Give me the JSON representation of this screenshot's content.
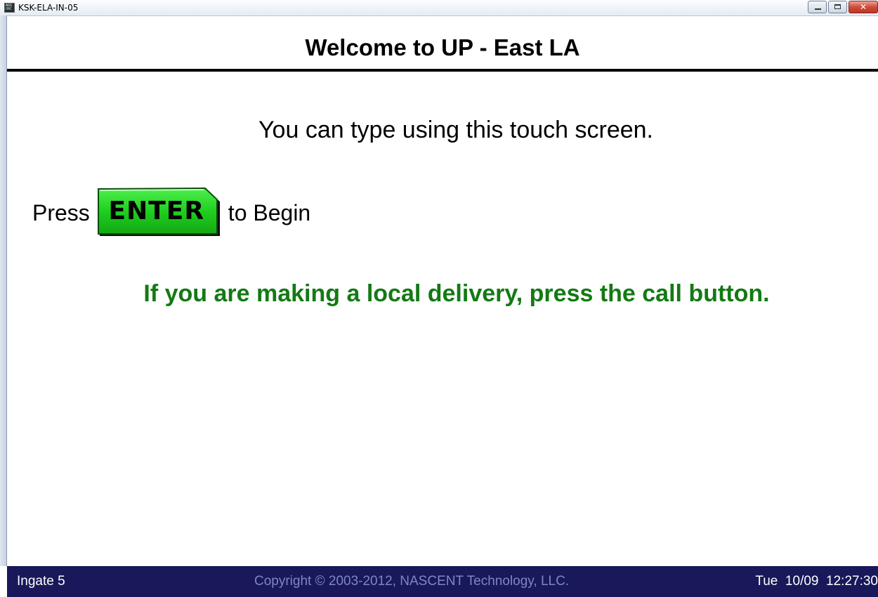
{
  "window": {
    "title": "KSK-ELA-IN-05",
    "icon": "app-icon",
    "icon_text_top": "AGS",
    "icon_text_bottom": "ONC"
  },
  "header": {
    "title": "Welcome to UP - East LA"
  },
  "main": {
    "touch_text": "You can type using this touch screen.",
    "press_label": "Press",
    "enter_label": "ENTER",
    "begin_label": "to Begin",
    "local_delivery_text": "If you are making a local delivery, press the call button."
  },
  "statusbar": {
    "location": "Ingate 5",
    "copyright": "Copyright © 2003-2012, NASCENT Technology, LLC.",
    "datetime": "Tue  10/09  12:27:30"
  },
  "colors": {
    "enter_button": "#1fcf1f",
    "local_delivery_text": "#137a14",
    "statusbar_bg": "#18185a",
    "copyright_text": "#7f86c4"
  }
}
